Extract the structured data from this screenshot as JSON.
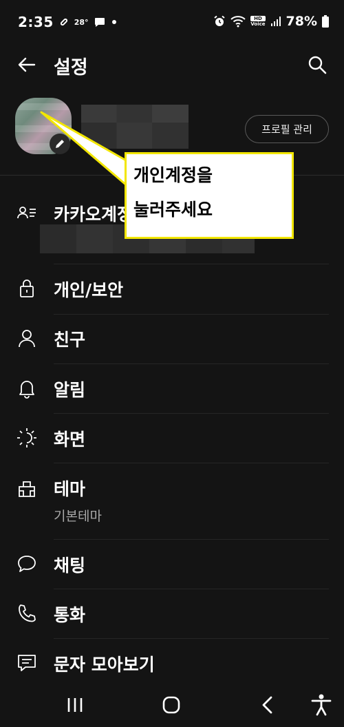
{
  "status_bar": {
    "time": "2:35",
    "temperature": "28°",
    "hd_label": "HD",
    "voice_label": "Voice",
    "battery": "78%",
    "icons": [
      "link-icon",
      "chat-bubble-icon",
      "dot-icon",
      "alarm-icon",
      "wifi-icon",
      "signal-icon",
      "battery-icon"
    ]
  },
  "header": {
    "title": "설정",
    "back_icon": "arrow-left-icon",
    "search_icon": "search-icon"
  },
  "profile": {
    "manage_button": "프로필 관리",
    "edit_icon": "pencil-icon"
  },
  "callout": {
    "line1": "개인계정을",
    "line2": "눌러주세요",
    "border_color": "#f2e600"
  },
  "menu": {
    "account": {
      "label": "카카오계정",
      "icon": "account-list-icon"
    },
    "privacy": {
      "label": "개인/보안",
      "icon": "lock-icon"
    },
    "friends": {
      "label": "친구",
      "icon": "person-icon"
    },
    "notifications": {
      "label": "알림",
      "icon": "bell-icon"
    },
    "display": {
      "label": "화면",
      "icon": "brightness-icon"
    },
    "theme": {
      "label": "테마",
      "sublabel": "기본테마",
      "icon": "theme-icon"
    },
    "chat": {
      "label": "채팅",
      "icon": "speech-bubble-icon"
    },
    "call": {
      "label": "통화",
      "icon": "phone-icon"
    },
    "sms": {
      "label": "문자 모아보기",
      "icon": "message-icon"
    }
  },
  "nav_bar": {
    "icons": [
      "recent-apps-icon",
      "home-icon",
      "back-icon",
      "accessibility-icon"
    ]
  },
  "colors": {
    "background": "#141414",
    "text": "#ffffff",
    "subtext": "#a8a8a8",
    "callout_border": "#f2e600"
  }
}
